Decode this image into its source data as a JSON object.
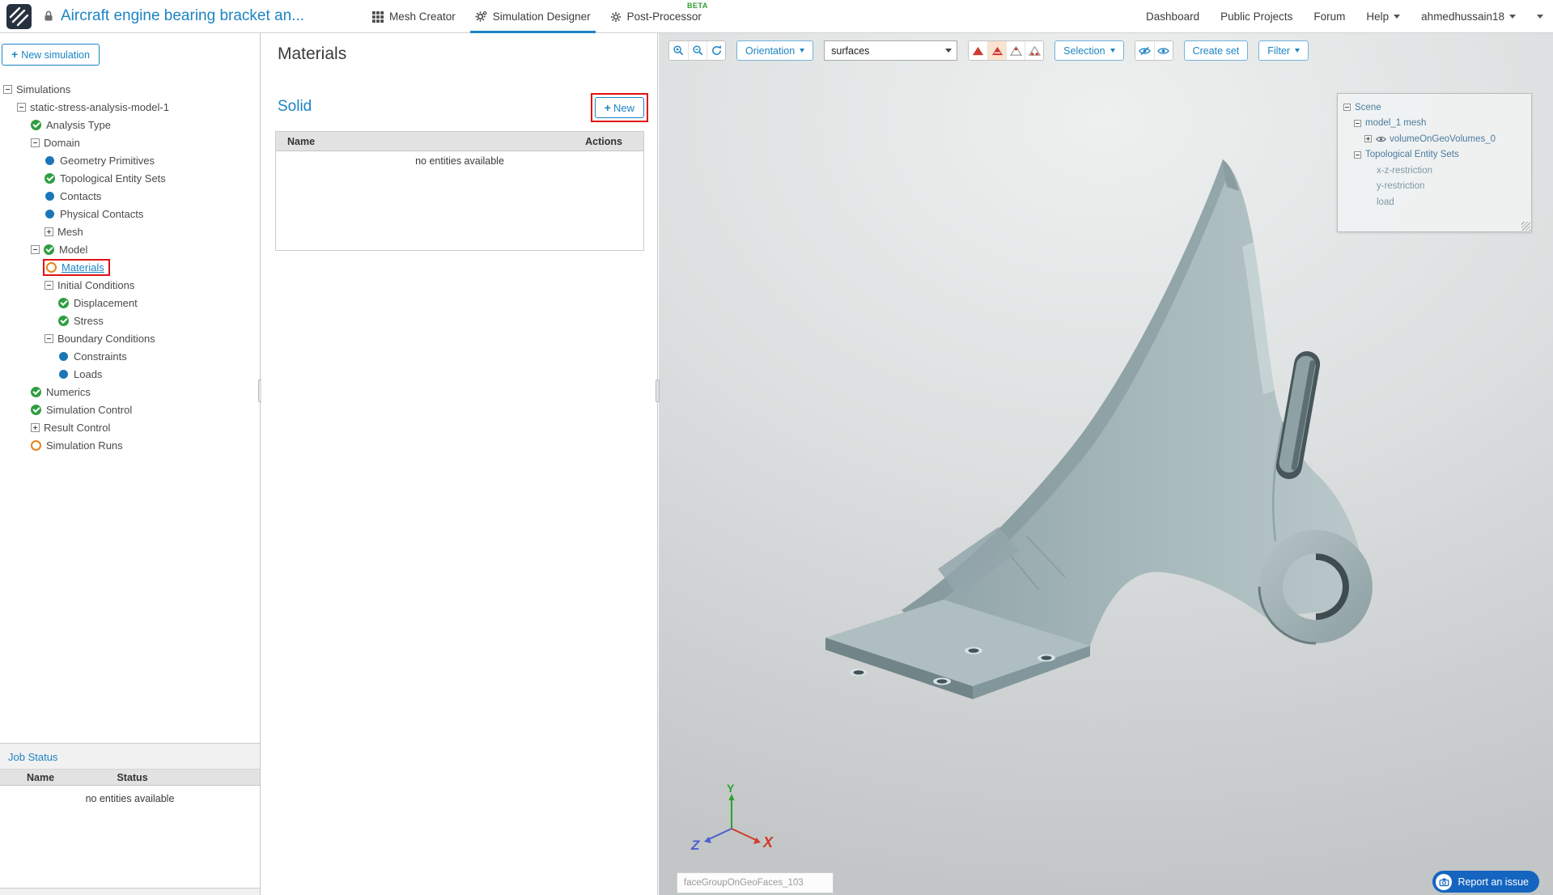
{
  "colors": {
    "accent": "#1d84c4",
    "annotation_red": "#e01212",
    "status_complete_green": "#2f9e41",
    "status_item_blue": "#1b76b8",
    "status_incomplete_orange": "#e8821e",
    "beta_green": "#2f9e2f",
    "report_button_blue": "#1565c0",
    "model_gray_teal": "#a7b9bc"
  },
  "topbar": {
    "project_title": "Aircraft engine bearing bracket an...",
    "tabs": [
      {
        "label": "Mesh Creator"
      },
      {
        "label": "Simulation Designer"
      },
      {
        "label": "Post-Processor",
        "badge": "BETA"
      }
    ],
    "links": {
      "dashboard": "Dashboard",
      "public_projects": "Public Projects",
      "forum": "Forum",
      "help": "Help"
    },
    "username": "ahmedhussain18"
  },
  "sidebar": {
    "new_simulation_button": "New simulation",
    "tree": [
      {
        "label": "Simulations",
        "level": 0,
        "twisty": "minus"
      },
      {
        "label": "static-stress-analysis-model-1",
        "level": 1,
        "twisty": "minus"
      },
      {
        "label": "Analysis Type",
        "level": 2,
        "icon": "check"
      },
      {
        "label": "Domain",
        "level": 2,
        "twisty": "minus"
      },
      {
        "label": "Geometry Primitives",
        "level": 3,
        "icon": "dot"
      },
      {
        "label": "Topological Entity Sets",
        "level": 3,
        "icon": "check"
      },
      {
        "label": "Contacts",
        "level": 3,
        "icon": "dot"
      },
      {
        "label": "Physical Contacts",
        "level": 3,
        "icon": "dot"
      },
      {
        "label": "Mesh",
        "level": 3,
        "twisty": "plus"
      },
      {
        "label": "Model",
        "level": 2,
        "twisty": "minus",
        "icon": "check"
      },
      {
        "label": "Materials",
        "level": 3,
        "icon": "circle",
        "highlight": true
      },
      {
        "label": "Initial Conditions",
        "level": 3,
        "twisty": "minus"
      },
      {
        "label": "Displacement",
        "level": 4,
        "icon": "check"
      },
      {
        "label": "Stress",
        "level": 4,
        "icon": "check"
      },
      {
        "label": "Boundary Conditions",
        "level": 3,
        "twisty": "minus"
      },
      {
        "label": "Constraints",
        "level": 4,
        "icon": "dot"
      },
      {
        "label": "Loads",
        "level": 4,
        "icon": "dot"
      },
      {
        "label": "Numerics",
        "level": 2,
        "icon": "check"
      },
      {
        "label": "Simulation Control",
        "level": 2,
        "icon": "check"
      },
      {
        "label": "Result Control",
        "level": 2,
        "twisty": "plus"
      },
      {
        "label": "Simulation Runs",
        "level": 2,
        "icon": "circle"
      }
    ],
    "job_status": {
      "title": "Job Status",
      "columns": [
        "Name",
        "Status"
      ],
      "empty_message": "no entities available"
    }
  },
  "materials_panel": {
    "title": "Materials",
    "section_title": "Solid",
    "new_button": "New",
    "table": {
      "columns": [
        "Name",
        "Actions"
      ],
      "empty_message": "no entities available"
    }
  },
  "viewport": {
    "toolbar": {
      "orientation_button": "Orientation",
      "render_mode_value": "surfaces",
      "selection_button": "Selection",
      "create_set_button": "Create set",
      "filter_button": "Filter"
    },
    "scene_tree": [
      {
        "label": "Scene",
        "level": 0,
        "twisty": "minus"
      },
      {
        "label": "model_1 mesh",
        "level": 1,
        "twisty": "minus"
      },
      {
        "label": "volumeOnGeoVolumes_0",
        "level": 2,
        "twisty": "plus",
        "eye": true
      },
      {
        "label": "Topological Entity Sets",
        "level": 1,
        "twisty": "minus"
      },
      {
        "label": "x-z-restriction",
        "level": 2,
        "muted": true
      },
      {
        "label": "y-restriction",
        "level": 2,
        "muted": true
      },
      {
        "label": "load",
        "level": 2,
        "muted": true
      }
    ],
    "axis": {
      "x": "X",
      "y": "Y",
      "z": "Z"
    },
    "face_group_value": "faceGroupOnGeoFaces_103",
    "report_issue_button": "Report an issue"
  }
}
